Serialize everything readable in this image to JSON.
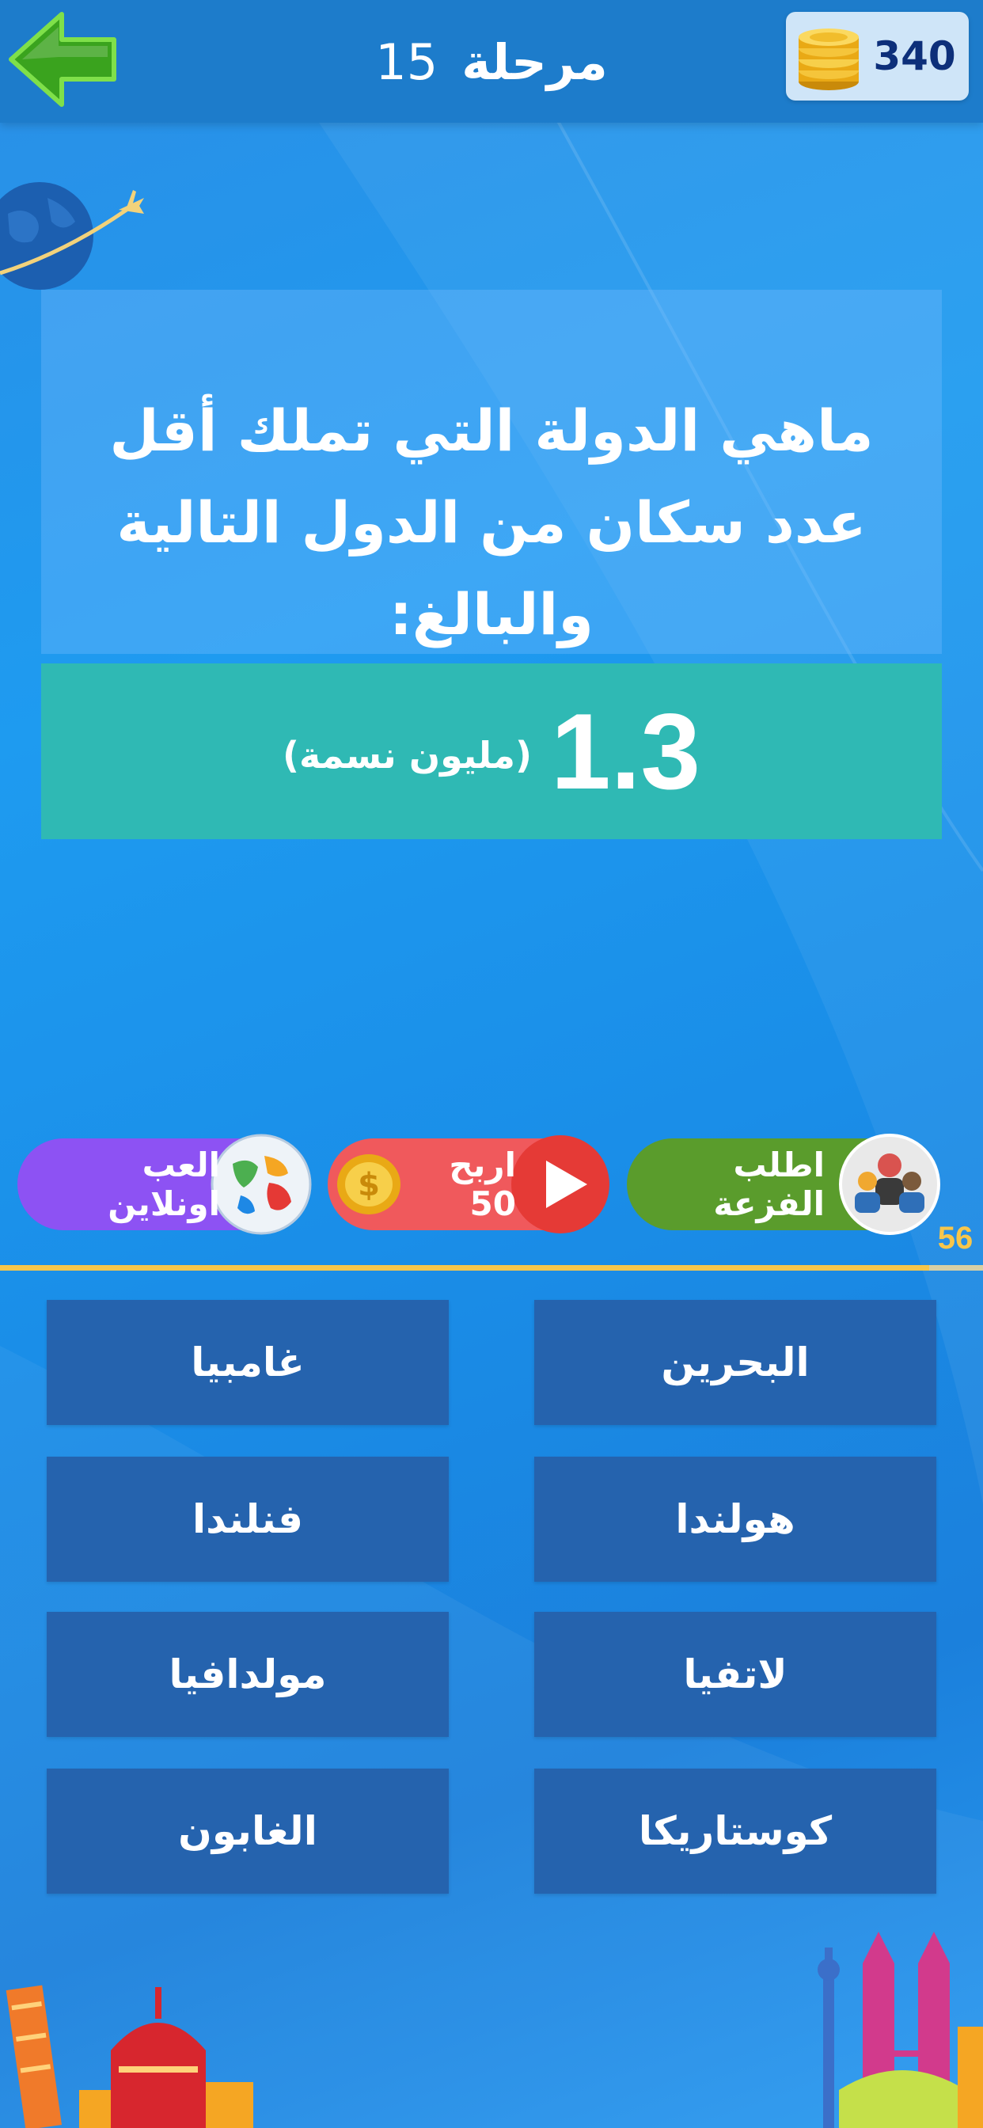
{
  "header": {
    "level_label": "مرحلة",
    "level_number": "15",
    "coins": "340"
  },
  "question": {
    "text": "ماهي الدولة التي تملك أقل عدد سكان من الدول التالية والبالغ:"
  },
  "hint": {
    "value": "1.3",
    "unit": "(مليون نسمة)"
  },
  "lifelines": {
    "help_label": "اطلب الفزعة",
    "earn_label": "اربح 50",
    "online_label": "العب اونلاين"
  },
  "timer": {
    "seconds": "56",
    "progress": 0.945
  },
  "answers": [
    "البحرين",
    "غامبيا",
    "هولندا",
    "فنلندا",
    "لاتفيا",
    "مولدافيا",
    "كوستاريكا",
    "الغابون"
  ],
  "colors": {
    "topbar": "#1d7ccb",
    "hint_card": "#2fb9b4",
    "answer_button": "#2563ae",
    "help_pill": "#5a9c2c",
    "earn_pill": "#f0595c",
    "online_pill": "#8d52f3",
    "timer": "#f7c64b"
  },
  "icons": {
    "back": "green-left-arrow-icon",
    "coins": "coin-stack-icon",
    "help": "people-group-icon",
    "earn": "play-video-icon",
    "online": "world-globe-icon"
  }
}
